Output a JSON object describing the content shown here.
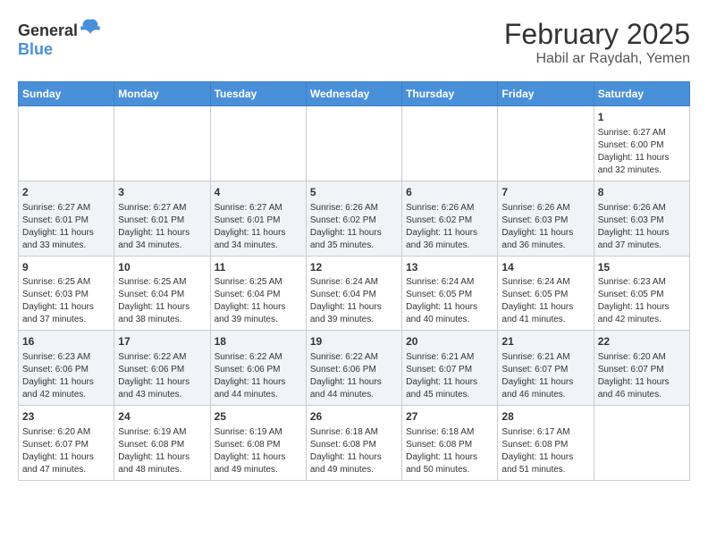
{
  "header": {
    "logo_general": "General",
    "logo_blue": "Blue",
    "title": "February 2025",
    "subtitle": "Habil ar Raydah, Yemen"
  },
  "days_of_week": [
    "Sunday",
    "Monday",
    "Tuesday",
    "Wednesday",
    "Thursday",
    "Friday",
    "Saturday"
  ],
  "weeks": [
    [
      {
        "day": "",
        "info": ""
      },
      {
        "day": "",
        "info": ""
      },
      {
        "day": "",
        "info": ""
      },
      {
        "day": "",
        "info": ""
      },
      {
        "day": "",
        "info": ""
      },
      {
        "day": "",
        "info": ""
      },
      {
        "day": "1",
        "info": "Sunrise: 6:27 AM\nSunset: 6:00 PM\nDaylight: 11 hours and 32 minutes."
      }
    ],
    [
      {
        "day": "2",
        "info": "Sunrise: 6:27 AM\nSunset: 6:01 PM\nDaylight: 11 hours and 33 minutes."
      },
      {
        "day": "3",
        "info": "Sunrise: 6:27 AM\nSunset: 6:01 PM\nDaylight: 11 hours and 34 minutes."
      },
      {
        "day": "4",
        "info": "Sunrise: 6:27 AM\nSunset: 6:01 PM\nDaylight: 11 hours and 34 minutes."
      },
      {
        "day": "5",
        "info": "Sunrise: 6:26 AM\nSunset: 6:02 PM\nDaylight: 11 hours and 35 minutes."
      },
      {
        "day": "6",
        "info": "Sunrise: 6:26 AM\nSunset: 6:02 PM\nDaylight: 11 hours and 36 minutes."
      },
      {
        "day": "7",
        "info": "Sunrise: 6:26 AM\nSunset: 6:03 PM\nDaylight: 11 hours and 36 minutes."
      },
      {
        "day": "8",
        "info": "Sunrise: 6:26 AM\nSunset: 6:03 PM\nDaylight: 11 hours and 37 minutes."
      }
    ],
    [
      {
        "day": "9",
        "info": "Sunrise: 6:25 AM\nSunset: 6:03 PM\nDaylight: 11 hours and 37 minutes."
      },
      {
        "day": "10",
        "info": "Sunrise: 6:25 AM\nSunset: 6:04 PM\nDaylight: 11 hours and 38 minutes."
      },
      {
        "day": "11",
        "info": "Sunrise: 6:25 AM\nSunset: 6:04 PM\nDaylight: 11 hours and 39 minutes."
      },
      {
        "day": "12",
        "info": "Sunrise: 6:24 AM\nSunset: 6:04 PM\nDaylight: 11 hours and 39 minutes."
      },
      {
        "day": "13",
        "info": "Sunrise: 6:24 AM\nSunset: 6:05 PM\nDaylight: 11 hours and 40 minutes."
      },
      {
        "day": "14",
        "info": "Sunrise: 6:24 AM\nSunset: 6:05 PM\nDaylight: 11 hours and 41 minutes."
      },
      {
        "day": "15",
        "info": "Sunrise: 6:23 AM\nSunset: 6:05 PM\nDaylight: 11 hours and 42 minutes."
      }
    ],
    [
      {
        "day": "16",
        "info": "Sunrise: 6:23 AM\nSunset: 6:06 PM\nDaylight: 11 hours and 42 minutes."
      },
      {
        "day": "17",
        "info": "Sunrise: 6:22 AM\nSunset: 6:06 PM\nDaylight: 11 hours and 43 minutes."
      },
      {
        "day": "18",
        "info": "Sunrise: 6:22 AM\nSunset: 6:06 PM\nDaylight: 11 hours and 44 minutes."
      },
      {
        "day": "19",
        "info": "Sunrise: 6:22 AM\nSunset: 6:06 PM\nDaylight: 11 hours and 44 minutes."
      },
      {
        "day": "20",
        "info": "Sunrise: 6:21 AM\nSunset: 6:07 PM\nDaylight: 11 hours and 45 minutes."
      },
      {
        "day": "21",
        "info": "Sunrise: 6:21 AM\nSunset: 6:07 PM\nDaylight: 11 hours and 46 minutes."
      },
      {
        "day": "22",
        "info": "Sunrise: 6:20 AM\nSunset: 6:07 PM\nDaylight: 11 hours and 46 minutes."
      }
    ],
    [
      {
        "day": "23",
        "info": "Sunrise: 6:20 AM\nSunset: 6:07 PM\nDaylight: 11 hours and 47 minutes."
      },
      {
        "day": "24",
        "info": "Sunrise: 6:19 AM\nSunset: 6:08 PM\nDaylight: 11 hours and 48 minutes."
      },
      {
        "day": "25",
        "info": "Sunrise: 6:19 AM\nSunset: 6:08 PM\nDaylight: 11 hours and 49 minutes."
      },
      {
        "day": "26",
        "info": "Sunrise: 6:18 AM\nSunset: 6:08 PM\nDaylight: 11 hours and 49 minutes."
      },
      {
        "day": "27",
        "info": "Sunrise: 6:18 AM\nSunset: 6:08 PM\nDaylight: 11 hours and 50 minutes."
      },
      {
        "day": "28",
        "info": "Sunrise: 6:17 AM\nSunset: 6:08 PM\nDaylight: 11 hours and 51 minutes."
      },
      {
        "day": "",
        "info": ""
      }
    ]
  ]
}
